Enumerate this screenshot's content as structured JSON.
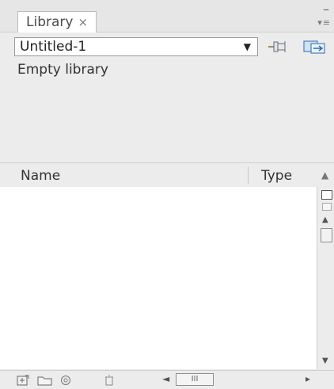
{
  "panel": {
    "tab_label": "Library",
    "tab_close": "×",
    "minimize": "–",
    "menu": "▾≡"
  },
  "document_select": {
    "value": "Untitled-1",
    "arrow": "▼"
  },
  "status_text": "Empty library",
  "columns": {
    "name": "Name",
    "type": "Type",
    "sort": "▲"
  },
  "vscroll": {
    "up": "▲",
    "down": "▼"
  },
  "hscroll": {
    "left": "◄",
    "thumb_grip": "III",
    "right": "▸"
  },
  "icons": [
    "pin-icon",
    "new-library-panel-icon",
    "new-symbol-icon",
    "new-folder-icon",
    "properties-icon",
    "delete-icon"
  ]
}
